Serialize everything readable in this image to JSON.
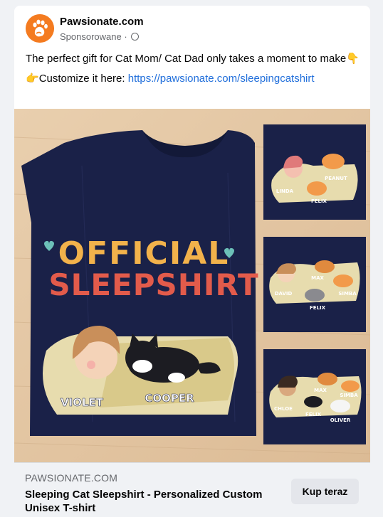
{
  "post": {
    "page_name": "Pawsionate.com",
    "sponsored_label": "Sponsorowane",
    "sponsored_separator": "·",
    "text_line1": "The perfect gift for Cat Mom/ Cat Dad only takes a moment to make",
    "text_line1_emoji": "👇",
    "text_line2_emoji": "👉",
    "text_line2_prefix": "Customize it here: ",
    "text_line2_link": "https://pawsionate.com/sleepingcatshirt"
  },
  "media": {
    "shirt_line1": "OFFICIAL",
    "shirt_line2": "SLEEPSHIRT",
    "main_person_name": "VIOLET",
    "main_cat_name": "COOPER",
    "thumb1": {
      "names": [
        "PEANUT",
        "LINDA",
        "FELIX"
      ]
    },
    "thumb2": {
      "names": [
        "MAX",
        "DAVID",
        "SIMBA",
        "FELIX"
      ]
    },
    "thumb3": {
      "names": [
        "MAX",
        "SIMBA",
        "CHLOE",
        "FELIX",
        "OLIVER"
      ]
    }
  },
  "footer": {
    "domain": "PAWSIONATE.COM",
    "title": "Sleeping Cat Sleepshirt - Personalized Custom Unisex T-shirt",
    "cta_label": "Kup teraz"
  },
  "colors": {
    "brand_orange": "#f47b20",
    "link_blue": "#216fdb",
    "shirt_navy": "#1a2148",
    "wood": "#e4c8a6"
  }
}
